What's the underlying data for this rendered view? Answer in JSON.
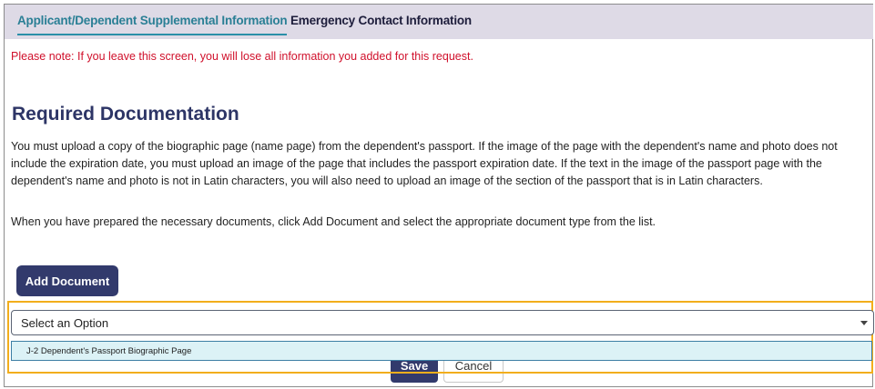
{
  "tabs": [
    {
      "label": "Applicant/Dependent Supplemental Information",
      "active": true
    },
    {
      "label": "Emergency Contact Information",
      "active": false
    }
  ],
  "note": "Please note: If you leave this screen, you will lose all information you added for this request.",
  "section": {
    "heading": "Required Documentation",
    "paragraph": "You must upload a copy of the biographic page (name page) from the dependent's passport. If the image of the page with the dependent's name and photo does not include the expiration date, you must upload an image of the page that includes the passport expiration date. If the text in the image of the passport page with the dependent's name and photo is not in Latin characters, you will also need to upload an image of the section of the passport that is in Latin characters.",
    "instructions": "When you have prepared the necessary documents, click Add Document and select the appropriate document type from the list."
  },
  "add_document_label": "Add Document",
  "document_type_select": {
    "selected": "Select an Option",
    "options": [
      "J-2 Dependent's Passport Biographic Page"
    ]
  },
  "footer": {
    "save_label": "Save",
    "cancel_label": "Cancel"
  },
  "colors": {
    "accent": "#2a7f95",
    "primary_button": "#323a6c",
    "warning_text": "#d0102b",
    "highlight_border": "#f2ae1c",
    "option_highlight": "#dcf2f6"
  }
}
